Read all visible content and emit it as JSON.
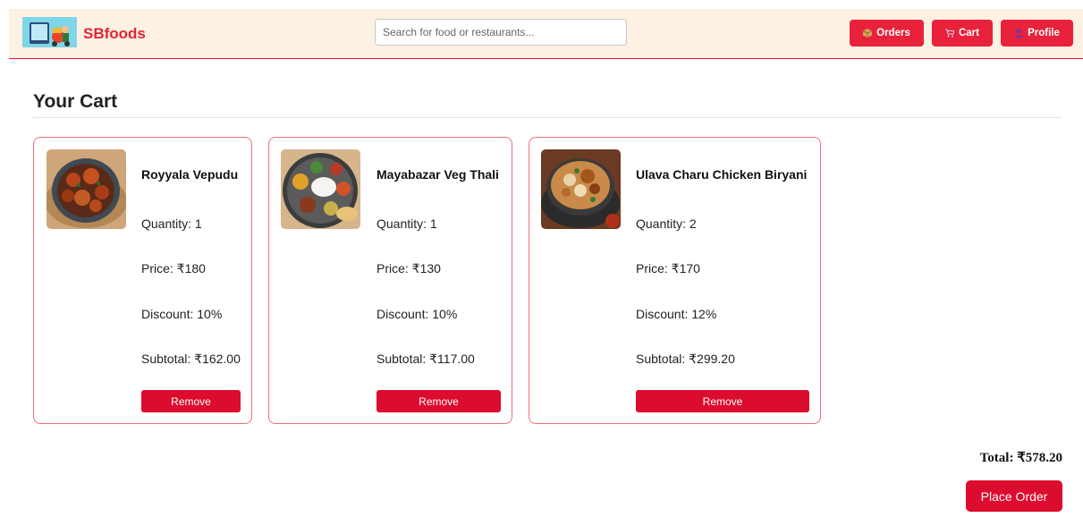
{
  "header": {
    "brand": "SBfoods",
    "search_placeholder": "Search for food or restaurants...",
    "orders_label": "Orders",
    "cart_label": "Cart",
    "profile_label": "Profile"
  },
  "page": {
    "title": "Your Cart"
  },
  "cart": {
    "items": [
      {
        "name": "Royyala Vepudu",
        "quantity": "Quantity: 1",
        "price": "Price: ₹180",
        "discount": "Discount: 10%",
        "subtotal": "Subtotal: ₹162.00",
        "remove_label": "Remove"
      },
      {
        "name": "Mayabazar Veg Thali",
        "quantity": "Quantity: 1",
        "price": "Price: ₹130",
        "discount": "Discount: 10%",
        "subtotal": "Subtotal: ₹117.00",
        "remove_label": "Remove"
      },
      {
        "name": "Ulava Charu Chicken Biryani",
        "quantity": "Quantity: 2",
        "price": "Price: ₹170",
        "discount": "Discount: 12%",
        "subtotal": "Subtotal: ₹299.20",
        "remove_label": "Remove"
      }
    ],
    "total": "Total: ₹578.20",
    "place_order_label": "Place Order"
  },
  "icons": {
    "orders": "package-icon",
    "cart": "cart-icon",
    "profile": "user-icon"
  },
  "colors": {
    "accent": "#e8223a",
    "header_bg": "#fdf1e3",
    "card_border": "#f07079"
  }
}
